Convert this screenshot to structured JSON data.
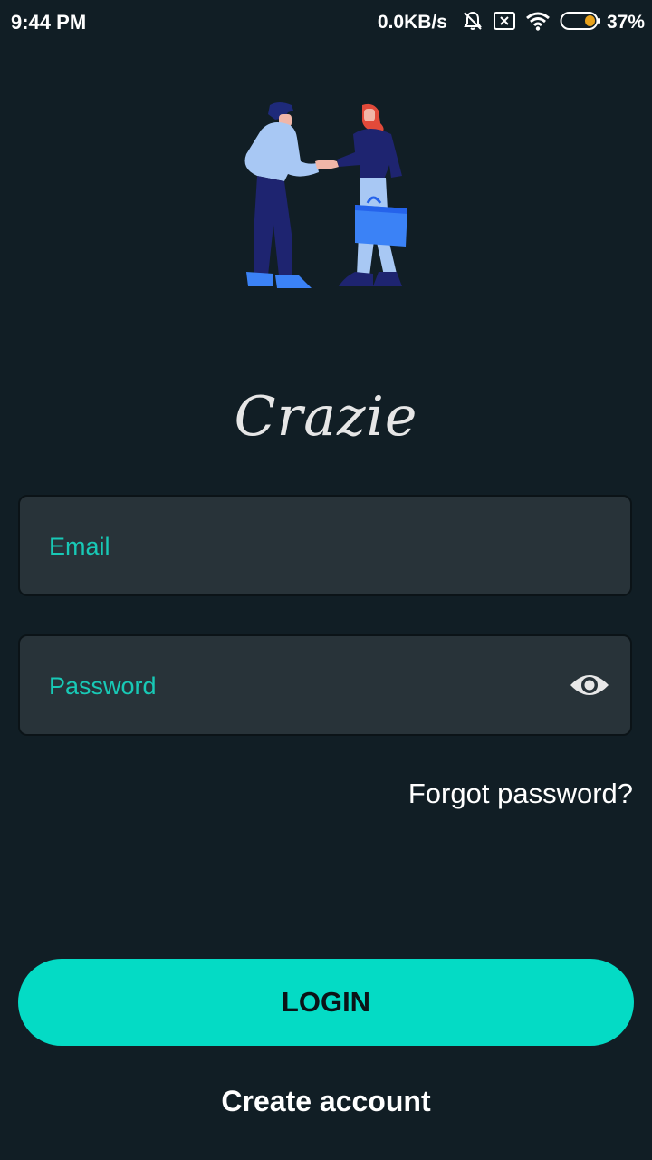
{
  "status_bar": {
    "time": "9:44 PM",
    "net_speed": "0.0KB/s",
    "battery_percent": "37%",
    "icons": [
      "bell-off-icon",
      "sim-x-icon",
      "wifi-icon",
      "battery-icon"
    ]
  },
  "brand": {
    "name": "Crazie"
  },
  "form": {
    "email_placeholder": "Email",
    "password_placeholder": "Password",
    "forgot_label": "Forgot password?"
  },
  "actions": {
    "login_label": "LOGIN",
    "create_account_label": "Create account"
  },
  "colors": {
    "background": "#111e25",
    "field_background": "#283339",
    "accent": "#04dbc5",
    "placeholder": "#18c9b6"
  }
}
